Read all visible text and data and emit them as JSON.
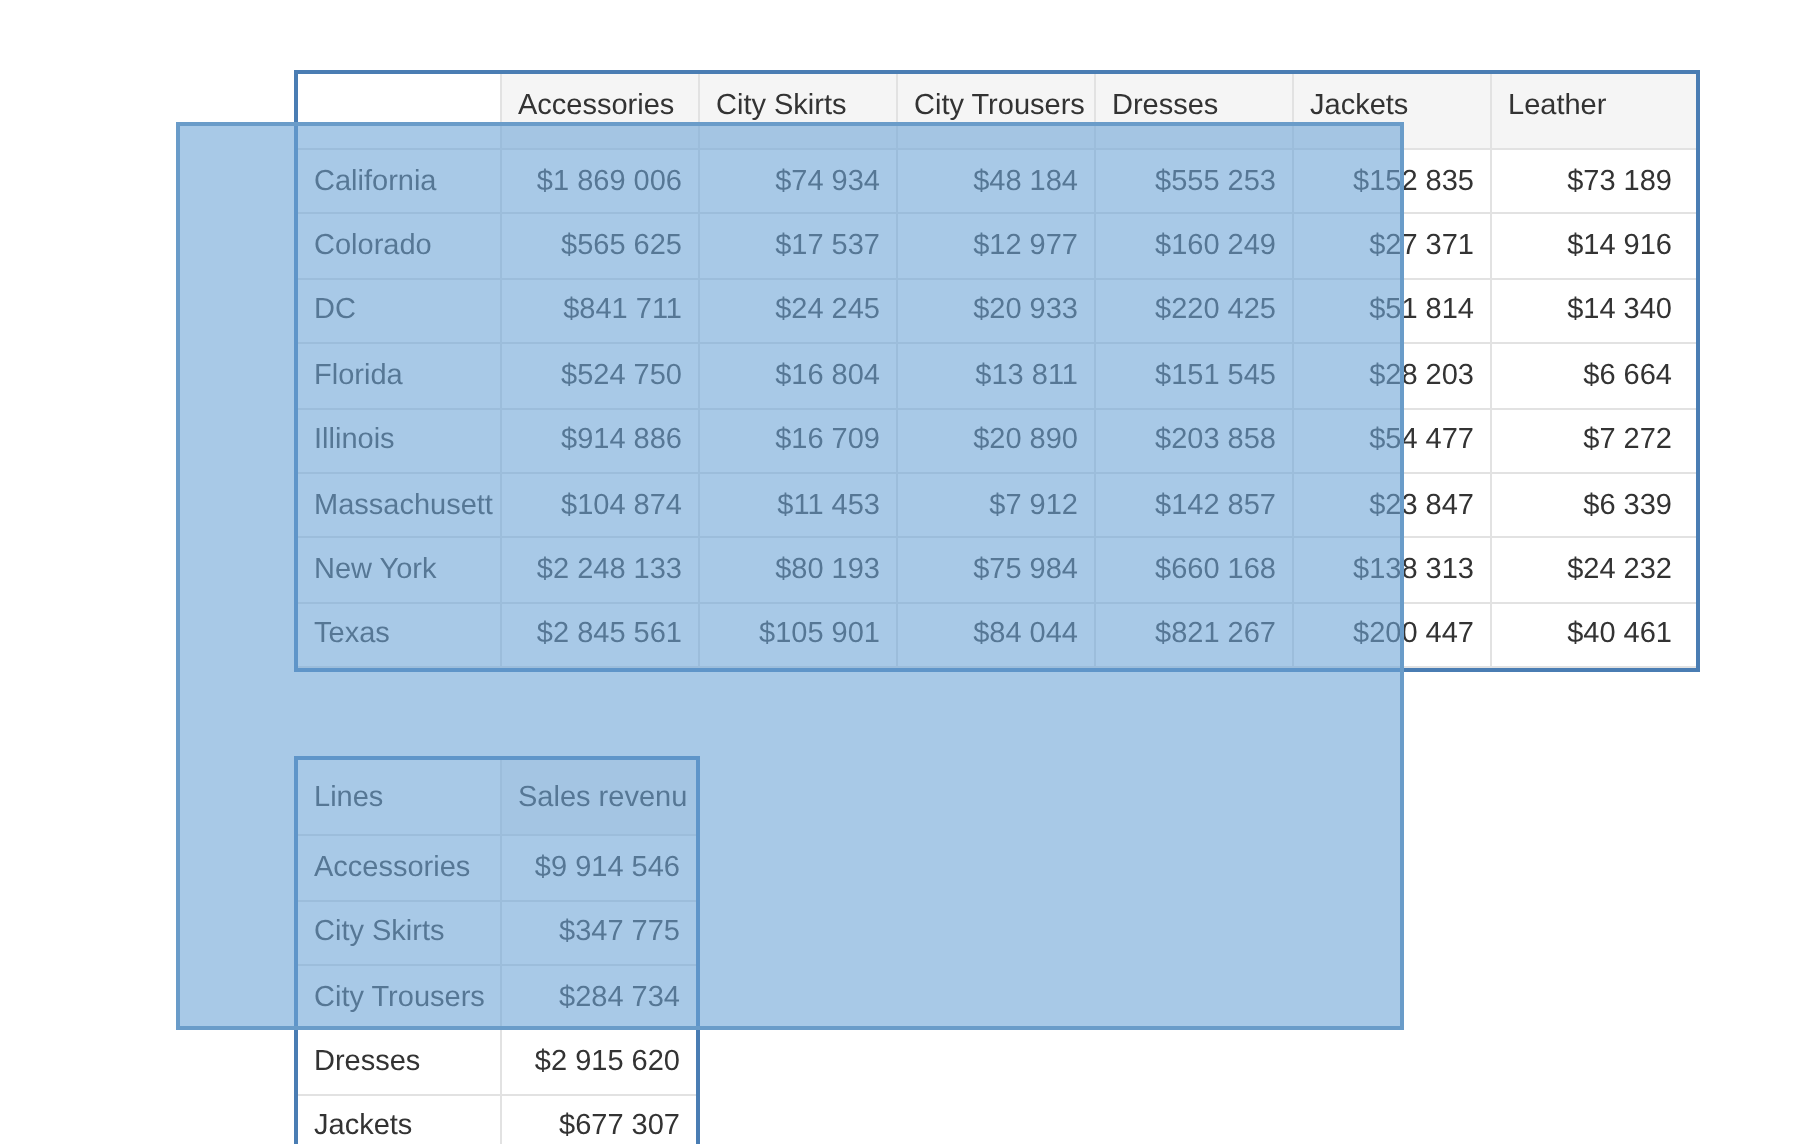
{
  "pivot_table": {
    "columns": [
      "Accessories",
      "City Skirts",
      "City Trousers",
      "Dresses",
      "Jackets",
      "Leather"
    ],
    "rows": [
      {
        "label": "California",
        "cells": [
          "$1 869 006",
          "$74 934",
          "$48 184",
          "$555 253",
          "$152 835",
          "$73 189"
        ]
      },
      {
        "label": "Colorado",
        "cells": [
          "$565 625",
          "$17 537",
          "$12 977",
          "$160 249",
          "$27 371",
          "$14 916"
        ]
      },
      {
        "label": "DC",
        "cells": [
          "$841 711",
          "$24 245",
          "$20 933",
          "$220 425",
          "$51 814",
          "$14 340"
        ]
      },
      {
        "label": "Florida",
        "cells": [
          "$524 750",
          "$16 804",
          "$13 811",
          "$151 545",
          "$28 203",
          "$6 664"
        ]
      },
      {
        "label": "Illinois",
        "cells": [
          "$914 886",
          "$16 709",
          "$20 890",
          "$203 858",
          "$54 477",
          "$7 272"
        ]
      },
      {
        "label": "Massachusett",
        "cells": [
          "$104 874",
          "$11 453",
          "$7 912",
          "$142 857",
          "$23 847",
          "$6 339"
        ]
      },
      {
        "label": "New York",
        "cells": [
          "$2 248 133",
          "$80 193",
          "$75 984",
          "$660 168",
          "$138 313",
          "$24 232"
        ]
      },
      {
        "label": "Texas",
        "cells": [
          "$2 845 561",
          "$105 901",
          "$84 044",
          "$821 267",
          "$200 447",
          "$40 461"
        ]
      }
    ]
  },
  "lines_table": {
    "columns": [
      "Lines",
      "Sales revenu"
    ],
    "rows": [
      {
        "label": "Accessories",
        "cells": [
          "$9 914 546"
        ]
      },
      {
        "label": "City Skirts",
        "cells": [
          "$347 775"
        ]
      },
      {
        "label": "City Trousers",
        "cells": [
          "$284 734"
        ]
      },
      {
        "label": "Dresses",
        "cells": [
          "$2 915 620"
        ]
      },
      {
        "label": "Jackets",
        "cells": [
          "$677 307"
        ]
      }
    ]
  }
}
